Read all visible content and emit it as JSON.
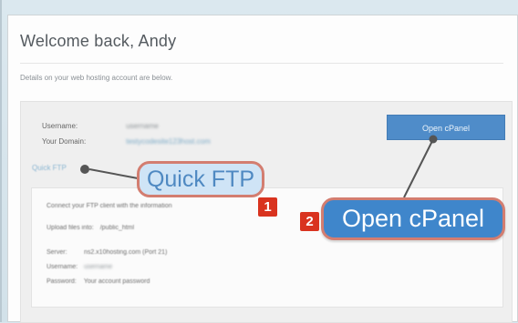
{
  "page": {
    "title": "Welcome back, Andy",
    "subtitle": "Details on your web hosting account are below."
  },
  "account": {
    "username_label": "Username:",
    "username_value": "username",
    "domain_label": "Your Domain:",
    "domain_value": "testycodesite123host.com"
  },
  "buttons": {
    "open_cpanel": "Open cPanel"
  },
  "quick_ftp": {
    "link": "Quick FTP",
    "intro": "Connect your FTP client with the information",
    "upload_label": "Upload files into:",
    "upload_value": "/public_html",
    "server_label": "Server:",
    "server_value": "ns2.x10hosting.com (Port 21)",
    "username_label": "Username:",
    "username_value": "username",
    "password_label": "Password:",
    "password_value": "Your account password"
  },
  "annotations": {
    "callout_ftp": "Quick FTP",
    "callout_cpanel": "Open cPanel",
    "step_1": "1",
    "step_2": "2"
  },
  "colors": {
    "accent": "#4f8cc9",
    "callout_blue": "#3f86cb",
    "callout_border": "#d37d70",
    "badge_red": "#d9331f",
    "background": "#d7e6ee"
  }
}
